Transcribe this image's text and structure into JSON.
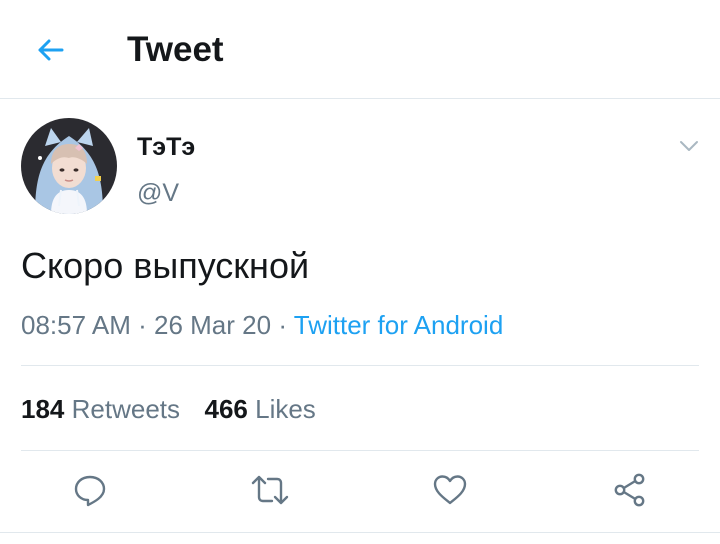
{
  "header": {
    "title": "Tweet",
    "back_icon": "arrow-left-icon"
  },
  "tweet": {
    "author": {
      "display_name": "ТэТэ",
      "handle": "@V"
    },
    "text": "Скоро выпускной",
    "time": "08:57 AM",
    "date": "26 Mar 20",
    "separator": "·",
    "source": "Twitter for Android",
    "stats": {
      "retweets_count": "184",
      "retweets_label": "Retweets",
      "likes_count": "466",
      "likes_label": "Likes"
    }
  },
  "actions": [
    "reply-icon",
    "retweet-icon",
    "like-icon",
    "share-icon"
  ],
  "colors": {
    "accent": "#1da1f2",
    "text_primary": "#14171a",
    "text_secondary": "#657786",
    "divider": "#e1e8ed",
    "icon": "#657786"
  }
}
